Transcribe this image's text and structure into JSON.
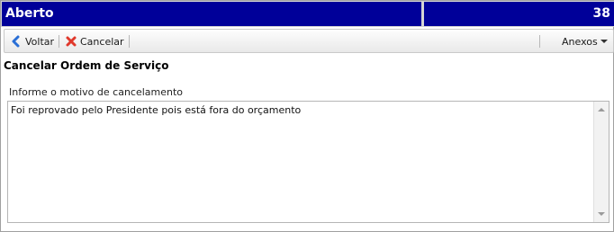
{
  "header": {
    "status": "Aberto",
    "number": "38"
  },
  "toolbar": {
    "back_label": "Voltar",
    "cancel_label": "Cancelar",
    "attachments_label": "Anexos"
  },
  "page": {
    "title": "Cancelar Ordem de Serviço"
  },
  "form": {
    "reason_label": "Informe o motivo de cancelamento",
    "reason_value": "Foi reprovado pelo Presidente pois está fora do orçamento"
  },
  "colors": {
    "header_bg": "#000099",
    "back_icon": "#2a6fd6",
    "cancel_icon": "#e0382b"
  }
}
